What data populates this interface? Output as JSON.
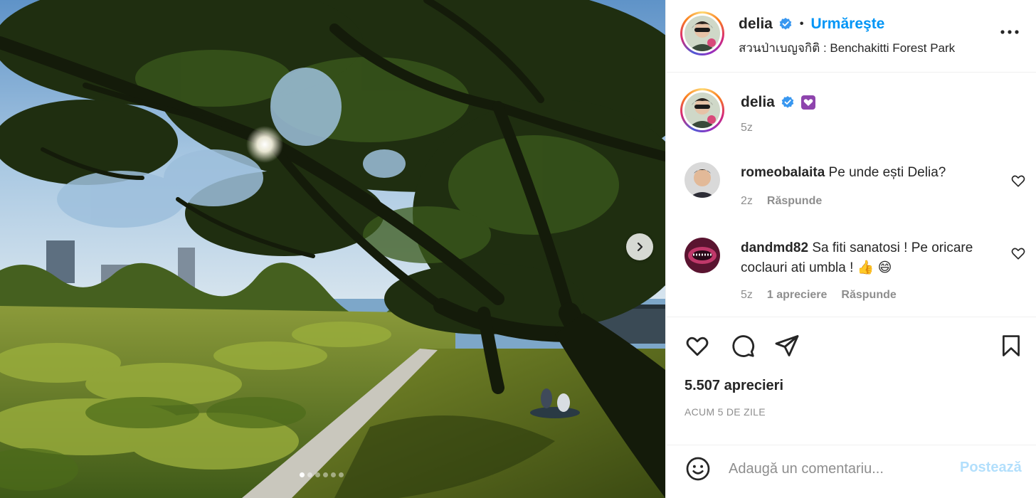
{
  "post": {
    "image_alt": "Benchakitti Forest Park trees",
    "carousel": {
      "total": 6,
      "active_index": 0
    }
  },
  "header": {
    "username": "delia",
    "separator": "•",
    "follow_label": "Urmăreşte",
    "location": "สวนป่าเบญจกิติ : Benchakitti Forest Park"
  },
  "caption": {
    "username": "delia",
    "time": "5z"
  },
  "comments": [
    {
      "username": "romeobalaita",
      "text": "Pe unde ești Delia?",
      "time": "2z",
      "likes": "",
      "reply_label": "Răspunde"
    },
    {
      "username": "dandmd82",
      "text": "Sa fiti sanatosi ! Pe oricare coclauri ati umbla ! ",
      "emojis": "👍 😄",
      "time": "5z",
      "likes": "1 apreciere",
      "reply_label": "Răspunde"
    }
  ],
  "stats": {
    "likes": "5.507 aprecieri",
    "date": "ACUM 5 DE ZILE"
  },
  "add_comment": {
    "placeholder": "Adaugă un comentariu...",
    "post_label": "Postează"
  },
  "colors": {
    "accent": "#0095f6",
    "verified": "#3897f0",
    "text": "#262626",
    "muted": "#8e8e8e",
    "post_disabled": "#b2dffc",
    "badge_purple": "#8e44ad"
  }
}
